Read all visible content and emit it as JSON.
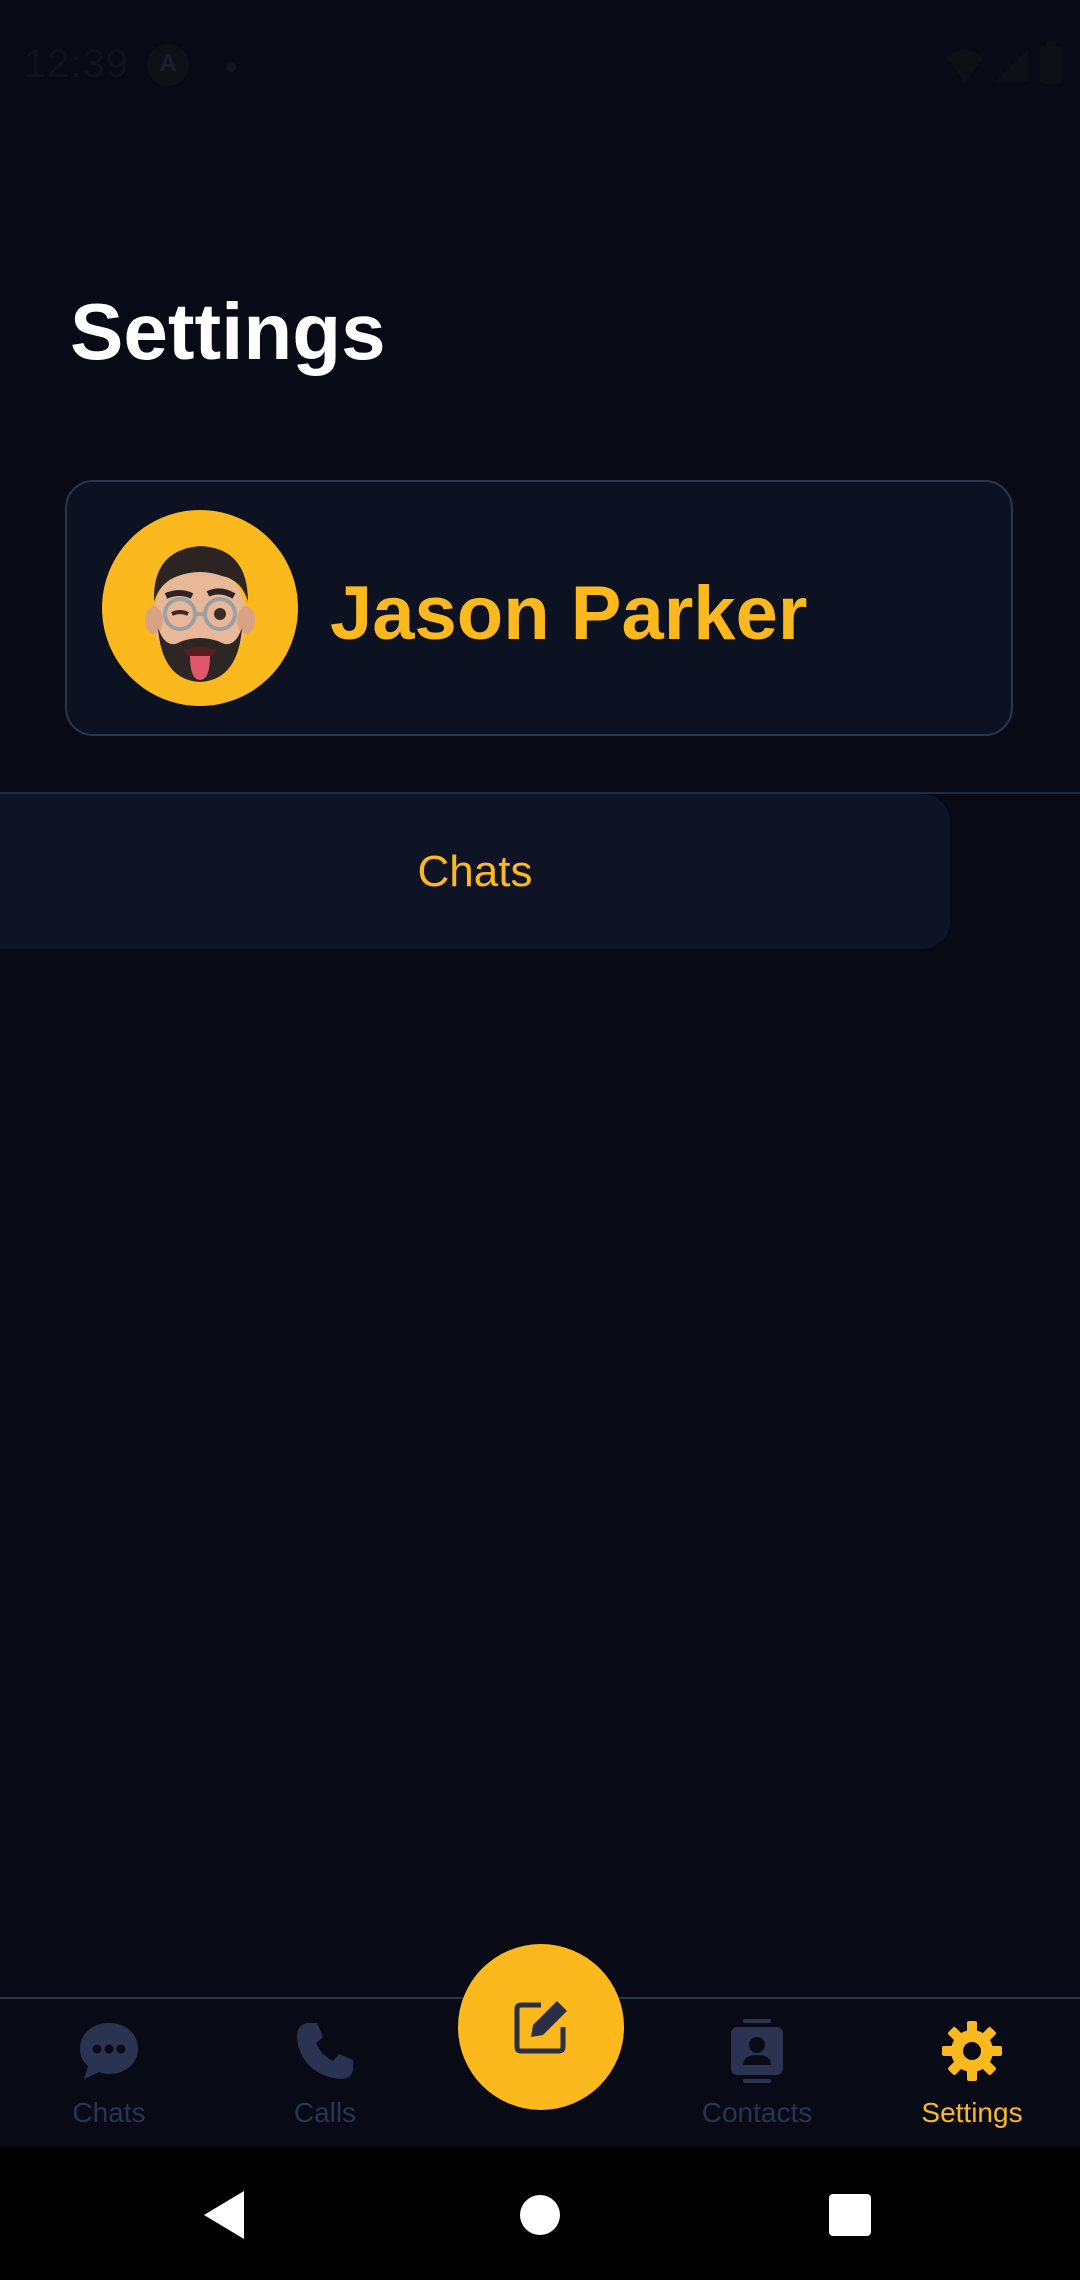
{
  "status_bar": {
    "time": "12:39",
    "icons": [
      "a-circle-icon",
      "dot-icon",
      "wifi-icon",
      "signal-icon",
      "battery-icon"
    ]
  },
  "page": {
    "title": "Settings"
  },
  "profile": {
    "name": "Jason Parker",
    "avatar": "memoji-avatar"
  },
  "settings_list": {
    "items": [
      {
        "label": "Chats"
      }
    ]
  },
  "bottom_nav": {
    "items": [
      {
        "label": "Chats",
        "icon": "chat-bubble-icon",
        "active": false
      },
      {
        "label": "Calls",
        "icon": "phone-icon",
        "active": false
      },
      {
        "label": "Contacts",
        "icon": "contacts-icon",
        "active": false
      },
      {
        "label": "Settings",
        "icon": "gear-icon",
        "active": true
      }
    ],
    "fab_icon": "edit-icon"
  },
  "colors": {
    "background": "#080b16",
    "accent": "#fbb91d",
    "card": "#0d1222",
    "inactive": "#2a3352"
  }
}
